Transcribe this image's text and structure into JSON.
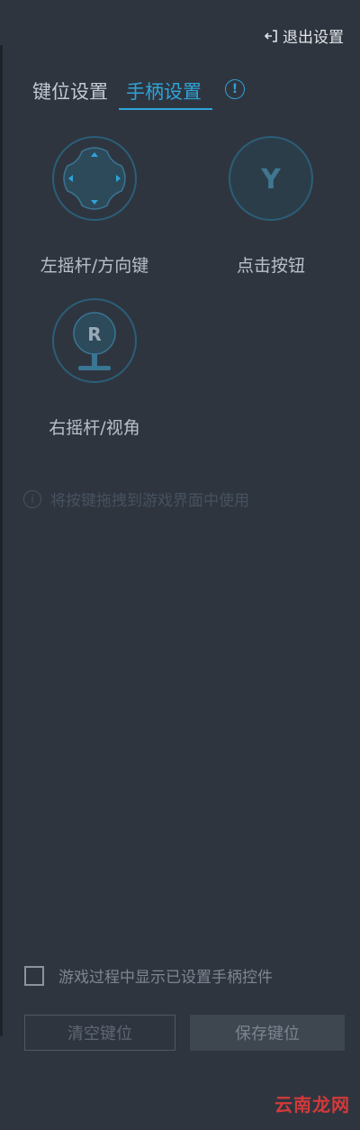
{
  "header": {
    "exit_label": "退出设置"
  },
  "tabs": [
    {
      "label": "键位设置",
      "active": false
    },
    {
      "label": "手柄设置",
      "active": true
    }
  ],
  "info_icon": "!",
  "controls": [
    {
      "label": "左摇杆/方向键",
      "icon": "dpad-icon"
    },
    {
      "label": "点击按钮",
      "icon": "y-button-icon",
      "glyph": "Y"
    },
    {
      "label": "右摇杆/视角",
      "icon": "joystick-icon",
      "glyph": "R"
    }
  ],
  "hint": {
    "text": "将按键拖拽到游戏界面中使用",
    "icon": "i"
  },
  "footer": {
    "show_controls_label": "游戏过程中显示已设置手柄控件",
    "show_controls_checked": false,
    "clear_label": "清空键位",
    "save_label": "保存键位"
  },
  "watermark": "云南龙网",
  "colors": {
    "background": "#2f353f",
    "accent": "#2fa3d8",
    "icon_stroke": "#2a5f78",
    "icon_fill": "#2c4a5a"
  }
}
